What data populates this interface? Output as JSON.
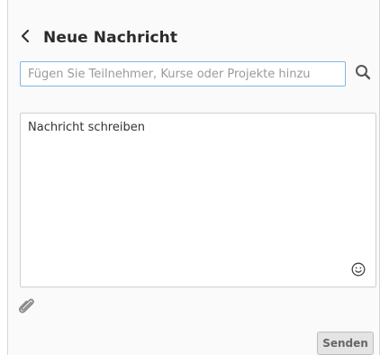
{
  "header": {
    "title": "Neue Nachricht",
    "back_icon": "chevron-left-icon"
  },
  "search": {
    "placeholder": "Fügen Sie Teilnehmer, Kurse oder Projekte hinzu",
    "value": "",
    "icon": "search-icon"
  },
  "message": {
    "placeholder": "Nachricht schreiben",
    "emoji_icon": "smiley-icon"
  },
  "attachment": {
    "icon": "paperclip-icon"
  },
  "actions": {
    "send_label": "Senden"
  },
  "colors": {
    "input_focus_border": "#7eb6e6",
    "send_button_bg": "#e4e4e4",
    "panel_bg": "#fafafa"
  }
}
